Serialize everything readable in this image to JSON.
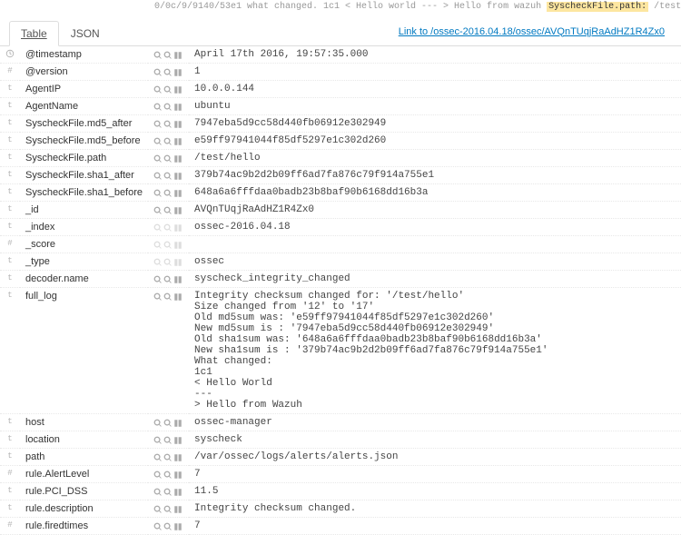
{
  "header": {
    "partial_prefix": "0/0c/9/9140/53e1   what changed. 1c1 < Hello world --- > Hello from wazuh  ",
    "highlight_label": "SyscheckFile.path:",
    "highlight_value": " /test/hello"
  },
  "tabs": [
    {
      "label": "Table",
      "active": true
    },
    {
      "label": "JSON",
      "active": false
    }
  ],
  "link_text": "Link to /ossec-2016.04.18/ossec/AVQnTUqjRaAdHZ1R4Zx0",
  "rows": [
    {
      "type": "clock",
      "name": "@timestamp",
      "value": "April 17th 2016, 19:57:35.000",
      "actions": true
    },
    {
      "type": "#",
      "name": "@version",
      "value": "1",
      "actions": true
    },
    {
      "type": "t",
      "name": "AgentIP",
      "value": "10.0.0.144",
      "actions": true
    },
    {
      "type": "t",
      "name": "AgentName",
      "value": "ubuntu",
      "actions": true
    },
    {
      "type": "t",
      "name": "SyscheckFile.md5_after",
      "value": "7947eba5d9cc58d440fb06912e302949",
      "actions": true
    },
    {
      "type": "t",
      "name": "SyscheckFile.md5_before",
      "value": "e59ff97941044f85df5297e1c302d260",
      "actions": true
    },
    {
      "type": "t",
      "name": "SyscheckFile.path",
      "value": "/test/hello",
      "actions": true
    },
    {
      "type": "t",
      "name": "SyscheckFile.sha1_after",
      "value": "379b74ac9b2d2b09ff6ad7fa876c79f914a755e1",
      "actions": true
    },
    {
      "type": "t",
      "name": "SyscheckFile.sha1_before",
      "value": "648a6a6fffdaa0badb23b8baf90b6168dd16b3a",
      "actions": true
    },
    {
      "type": "t",
      "name": "_id",
      "value": "AVQnTUqjRaAdHZ1R4Zx0",
      "actions": true
    },
    {
      "type": "t",
      "name": "_index",
      "value": "ossec-2016.04.18",
      "actions": false
    },
    {
      "type": "#",
      "name": "_score",
      "value": "",
      "actions": false
    },
    {
      "type": "t",
      "name": "_type",
      "value": "ossec",
      "actions": false
    },
    {
      "type": "t",
      "name": "decoder.name",
      "value": "syscheck_integrity_changed",
      "actions": true
    },
    {
      "type": "t",
      "name": "full_log",
      "value": "Integrity checksum changed for: '/test/hello'\nSize changed from '12' to '17'\nOld md5sum was: 'e59ff97941044f85df5297e1c302d260'\nNew md5sum is : '7947eba5d9cc58d440fb06912e302949'\nOld sha1sum was: '648a6a6fffdaa0badb23b8baf90b6168dd16b3a'\nNew sha1sum is : '379b74ac9b2d2b09ff6ad7fa876c79f914a755e1'\nWhat changed:\n1c1\n< Hello World\n---\n> Hello from Wazuh",
      "actions": true
    },
    {
      "type": "t",
      "name": "host",
      "value": "ossec-manager",
      "actions": true
    },
    {
      "type": "t",
      "name": "location",
      "value": "syscheck",
      "actions": true
    },
    {
      "type": "t",
      "name": "path",
      "value": "/var/ossec/logs/alerts/alerts.json",
      "actions": true
    },
    {
      "type": "#",
      "name": "rule.AlertLevel",
      "value": "7",
      "actions": true
    },
    {
      "type": "t",
      "name": "rule.PCI_DSS",
      "value": "11.5",
      "actions": true
    },
    {
      "type": "t",
      "name": "rule.description",
      "value": "Integrity checksum changed.",
      "actions": true
    },
    {
      "type": "#",
      "name": "rule.firedtimes",
      "value": "7",
      "actions": true
    }
  ]
}
